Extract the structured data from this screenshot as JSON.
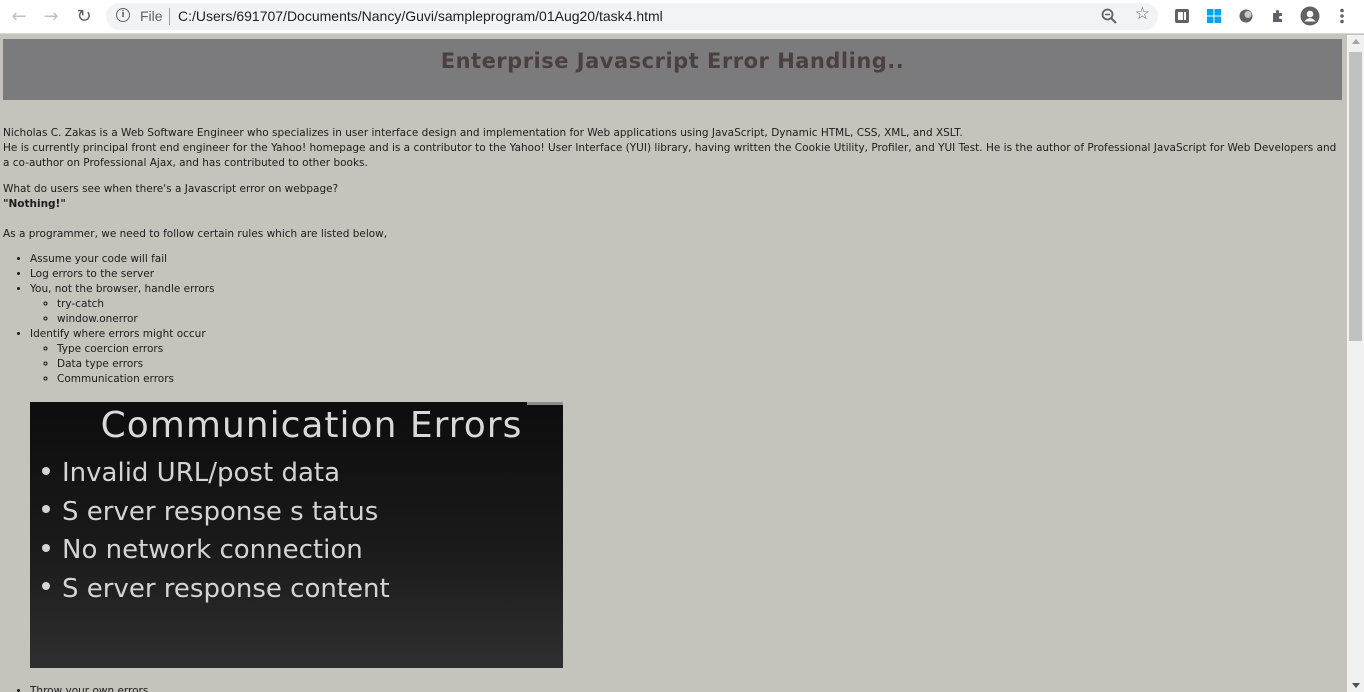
{
  "browser": {
    "file_label": "File",
    "url": "C:/Users/691707/Documents/Nancy/Guvi/sampleprogram/01Aug20/task4.html"
  },
  "page": {
    "heading": "Enterprise Javascript Error Handling..",
    "bio_line1": "Nicholas C. Zakas is a Web Software Engineer who specializes in user interface design and implementation for Web applications using JavaScript, Dynamic HTML, CSS, XML, and XSLT.",
    "bio_line2": "He is currently principal front end engineer for the Yahoo! homepage and is a contributor to the Yahoo! User Interface (YUI) library, having written the Cookie Utility, Profiler, and YUI Test. He is the author of Professional JavaScript for Web Developers and a co-author on Professional Ajax, and has contributed to other books.",
    "question": "What do users see when there's a Javascript error on webpage?",
    "answer": "\"Nothing!\"",
    "intro": "As a programmer, we need to follow certain rules which are listed below,",
    "rules": [
      {
        "label": "Assume your code will fail",
        "sub": []
      },
      {
        "label": "Log errors to the server",
        "sub": []
      },
      {
        "label": "You, not the browser, handle errors",
        "sub": [
          "try-catch",
          "window.onerror"
        ]
      },
      {
        "label": "Identify where errors might occur",
        "sub": [
          "Type coercion errors",
          "Data type errors",
          "Communication errors"
        ]
      }
    ],
    "slide": {
      "title": "Communication Errors",
      "items": [
        "Invalid URL/post data",
        "S erver response s tatus",
        "No network connection",
        "S erver response content"
      ]
    },
    "after_slide_item": "Throw your own errors"
  }
}
